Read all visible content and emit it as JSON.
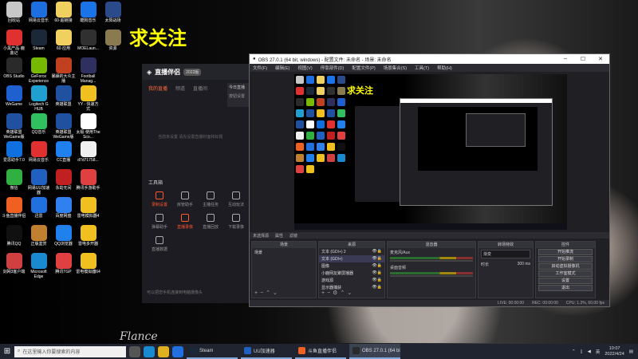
{
  "desktop": {
    "overlay_text": "求关注",
    "signature": "Flance",
    "icons": [
      {
        "label": "回收站",
        "color": "#c8c8c8"
      },
      {
        "label": "网易云音乐",
        "color": "#1d6fe0"
      },
      {
        "label": "60·超链接",
        "color": "#f0d060"
      },
      {
        "label": "酷狗音乐",
        "color": "#1a73e8"
      },
      {
        "label": "太阳战场",
        "color": "#2a4a8a"
      },
      {
        "label": "小黑产品·鹿鼎记",
        "color": "#e03030"
      },
      {
        "label": "Steam",
        "color": "#1b2838"
      },
      {
        "label": "60·应用",
        "color": "#f0d060"
      },
      {
        "label": "MOELaun...",
        "color": "#303030"
      },
      {
        "label": "资源",
        "color": "#8a7a50"
      },
      {
        "label": "OBS Studio",
        "color": "#2a2a2a"
      },
      {
        "label": "GeForce Experience",
        "color": "#76b900"
      },
      {
        "label": "暴躁的大众主播",
        "color": "#c04020"
      },
      {
        "label": "Football Manag...",
        "color": "#303060"
      },
      {
        "label": "",
        "color": "#000000"
      },
      {
        "label": "WeGame",
        "color": "#1e60d0"
      },
      {
        "label": "Logitech G HUB",
        "color": "#20a0d0"
      },
      {
        "label": "英雄联盟",
        "color": "#2050a0"
      },
      {
        "label": "YY - 快速方式",
        "color": "#f0c020"
      },
      {
        "label": "",
        "color": "#000000"
      },
      {
        "label": "英雄联盟WeGame版",
        "color": "#2050a0"
      },
      {
        "label": "QQ音乐",
        "color": "#30c060"
      },
      {
        "label": "英雄联盟WeGame版",
        "color": "#2050a0"
      },
      {
        "label": "太极·使用The Sco...",
        "color": "#ffffff"
      },
      {
        "label": "",
        "color": "#000000"
      },
      {
        "label": "爱思助手7.0",
        "color": "#1070e0"
      },
      {
        "label": "网易云音乐",
        "color": "#e03030"
      },
      {
        "label": "CC直播",
        "color": "#2080f0"
      },
      {
        "label": "d7d71758...",
        "color": "#f0f0f0"
      },
      {
        "label": "",
        "color": "#000000"
      },
      {
        "label": "微信",
        "color": "#30b040"
      },
      {
        "label": "网易UU加速器",
        "color": "#2060c0"
      },
      {
        "label": "永劫无间",
        "color": "#c02020"
      },
      {
        "label": "腾讯手游助手",
        "color": "#e04040"
      },
      {
        "label": "",
        "color": "#000000"
      },
      {
        "label": "斗鱼直播伴侣",
        "color": "#f06020"
      },
      {
        "label": "迅雷",
        "color": "#2070e0"
      },
      {
        "label": "百度网盘",
        "color": "#3080f0"
      },
      {
        "label": "雷电模拟器4",
        "color": "#f0c020"
      },
      {
        "label": "",
        "color": "#000000"
      },
      {
        "label": "腾讯QQ",
        "color": "#101010"
      },
      {
        "label": "正版鉴赏",
        "color": "#c08030"
      },
      {
        "label": "QQ浏览器",
        "color": "#2080f0"
      },
      {
        "label": "雷电多开器",
        "color": "#f0c020"
      },
      {
        "label": "",
        "color": "#000000"
      },
      {
        "label": "剑网3客户端",
        "color": "#d04040"
      },
      {
        "label": "Microsoft Edge",
        "color": "#1a8ad0"
      },
      {
        "label": "腾讯TGP",
        "color": "#e04040"
      },
      {
        "label": "雷电模拟器64",
        "color": "#f0c020"
      },
      {
        "label": "",
        "color": "#000000"
      }
    ]
  },
  "streamer_app": {
    "title": "直播伴侣",
    "badge": "2022版",
    "tabs": [
      "我的直播",
      "频道",
      "直播间"
    ],
    "hint": "当前未设置 请先设置直播封面和标题",
    "tools_label": "工具箱",
    "tools": [
      {
        "label": "录制设置",
        "active": true
      },
      {
        "label": "房管助手",
        "active": false
      },
      {
        "label": "主播任务",
        "active": false
      },
      {
        "label": "互动玩法",
        "active": false
      },
      {
        "label": "弹幕助手",
        "active": false
      },
      {
        "label": "直播录像",
        "active": true
      },
      {
        "label": "直播回放",
        "active": false
      },
      {
        "label": "下载录像",
        "active": false
      },
      {
        "label": "直播数据",
        "active": false
      }
    ],
    "footer": "可以把您手机连接到电脑摄像头",
    "side_title": "今日直播",
    "side_btn": "按钮设置"
  },
  "obs": {
    "title": "OBS 27.0.1 (64 bit, windows) - 配置文件: 未命名 - 场景: 未命名",
    "menu": [
      "文件(F)",
      "编辑(E)",
      "视图(V)",
      "停靠部件(D)",
      "配置文件(P)",
      "场景集合(S)",
      "工具(T)",
      "帮助(H)"
    ],
    "preview_follow_text": "求关注",
    "subbar": {
      "left": "未选择源",
      "properties": "属性",
      "filters": "滤镜"
    },
    "docks": {
      "scenes": {
        "title": "场景",
        "items": [
          "场景"
        ]
      },
      "sources": {
        "title": "来源",
        "items": [
          "文本 (GDI+) 2",
          "文本 (GDI+)",
          "图像",
          "小鹿网友聚屏播器",
          "游戏源",
          "显示器捕获"
        ]
      },
      "mixer": {
        "title": "混音器",
        "channels": [
          "麦克风/Aux",
          "桌面音频"
        ]
      },
      "transitions": {
        "title": "转场特效",
        "type_label": "渐变",
        "duration_label": "时长",
        "duration": "300 ms"
      },
      "controls": {
        "title": "控件",
        "buttons": [
          "开始推流",
          "开始录制",
          "启动虚拟摄像机",
          "工作室模式",
          "设置",
          "退出"
        ]
      }
    },
    "status": {
      "live": "LIVE: 00:00:00",
      "rec": "REC: 00:00:00",
      "cpu": "CPU: 1.3%, 60.00 fps"
    }
  },
  "taskbar": {
    "search_placeholder": "在这里输入你要搜索的内容",
    "tasks": [
      {
        "label": "Steam",
        "color": "#1b2838",
        "active": false
      },
      {
        "label": "UU加速器",
        "color": "#2060c0",
        "active": false
      },
      {
        "label": "斗鱼直播伴侣",
        "color": "#f06020",
        "active": false
      },
      {
        "label": "OBS 27.0.1 (64 bit...",
        "color": "#2a2a2a",
        "active": true
      }
    ],
    "time": "10:07",
    "date": "2022/4/24",
    "lang": "英"
  }
}
